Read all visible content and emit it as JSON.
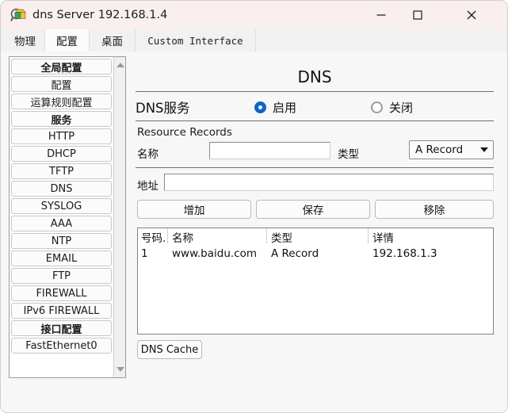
{
  "window": {
    "title": "dns Server 192.168.1.4",
    "icon": "packet-tracer-server-icon",
    "minimize": "─",
    "maximize": "□",
    "close": "✕"
  },
  "tabs": [
    {
      "label": "物理",
      "active": false
    },
    {
      "label": "配置",
      "active": true
    },
    {
      "label": "桌面",
      "active": false
    },
    {
      "label": "Custom Interface",
      "active": false
    }
  ],
  "sidebar": {
    "items": [
      {
        "label": "全局配置",
        "header": true
      },
      {
        "label": "配置",
        "header": false
      },
      {
        "label": "运算规则配置",
        "header": false
      },
      {
        "label": "服务",
        "header": true
      },
      {
        "label": "HTTP",
        "header": false
      },
      {
        "label": "DHCP",
        "header": false
      },
      {
        "label": "TFTP",
        "header": false
      },
      {
        "label": "DNS",
        "header": false
      },
      {
        "label": "SYSLOG",
        "header": false
      },
      {
        "label": "AAA",
        "header": false
      },
      {
        "label": "NTP",
        "header": false
      },
      {
        "label": "EMAIL",
        "header": false
      },
      {
        "label": "FTP",
        "header": false
      },
      {
        "label": "FIREWALL",
        "header": false
      },
      {
        "label": "IPv6 FIREWALL",
        "header": false
      },
      {
        "label": "接口配置",
        "header": true
      },
      {
        "label": "FastEthernet0",
        "header": false
      }
    ],
    "scroll_up_icon": "triangle-up-icon",
    "scroll_down_icon": "triangle-down-icon"
  },
  "panel": {
    "title": "DNS",
    "service_label": "DNS服务",
    "radio_on_label": "启用",
    "radio_off_label": "关闭",
    "service_enabled": true,
    "resource_records_label": "Resource Records",
    "name_label": "名称",
    "name_value": "",
    "type_label": "类型",
    "type_value": "A Record",
    "address_label": "地址",
    "address_value": "",
    "add_button": "增加",
    "save_button": "保存",
    "remove_button": "移除",
    "dns_cache_button": "DNS Cache",
    "accent_color": "#0f64c8"
  },
  "records_table": {
    "columns": [
      "号码.",
      "名称",
      "类型",
      "详情"
    ],
    "rows": [
      {
        "no": "1",
        "name": "www.baidu.com",
        "type": "A Record",
        "detail": "192.168.1.3"
      }
    ]
  }
}
